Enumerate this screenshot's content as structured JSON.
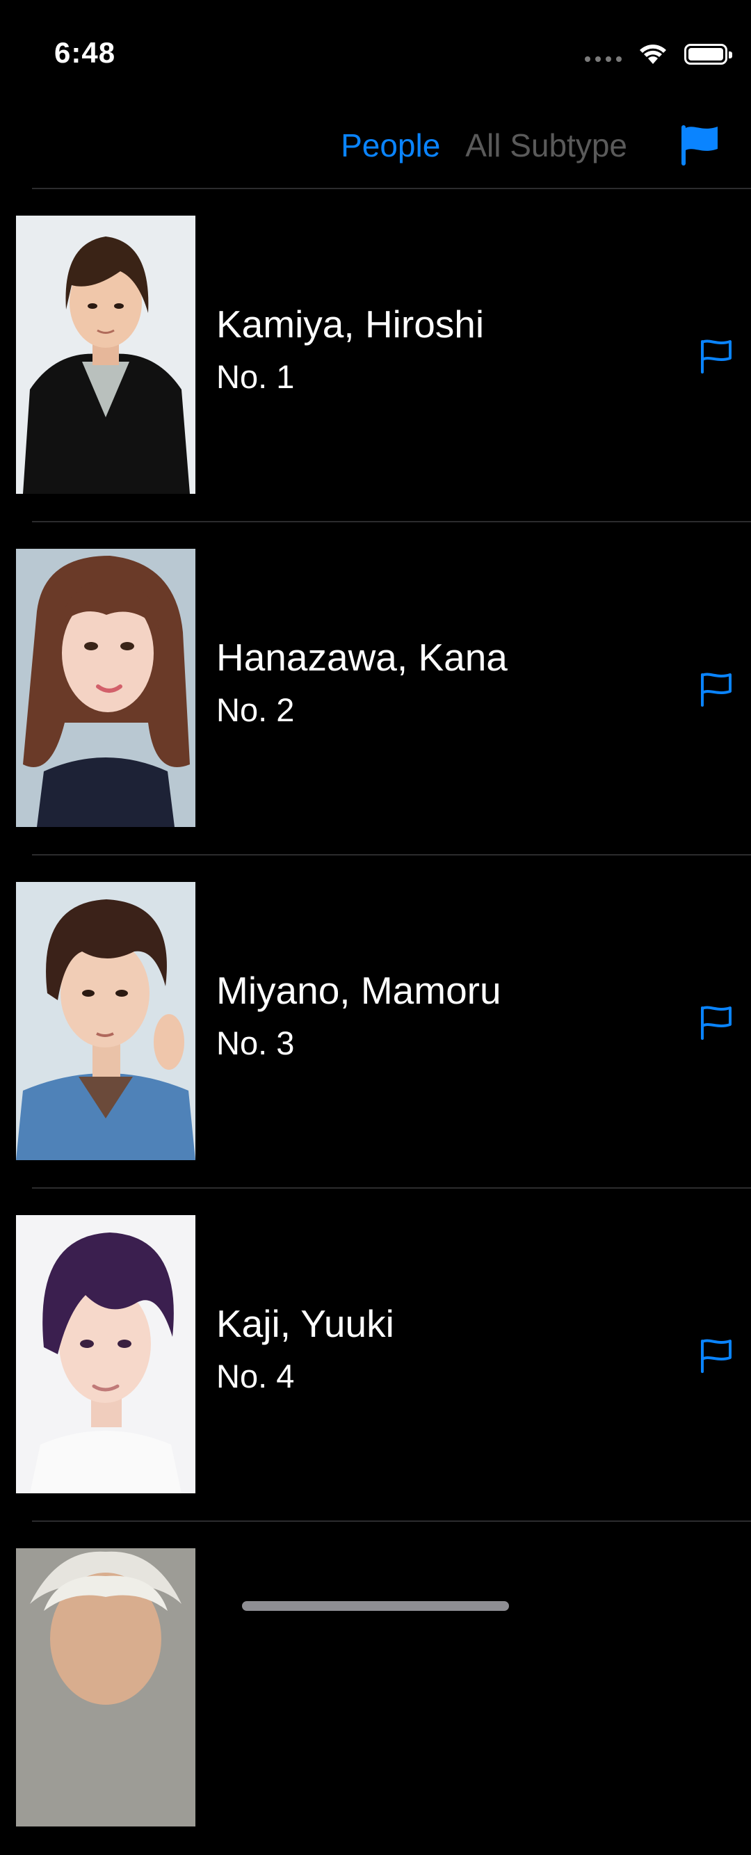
{
  "status_bar": {
    "time": "6:48"
  },
  "nav": {
    "segments": [
      {
        "label": "People",
        "selected": true
      },
      {
        "label": "All Subtype",
        "selected": false
      }
    ],
    "flag_icon": "flag-filled-icon"
  },
  "colors": {
    "accent": "#0a84ff",
    "background": "#000000",
    "divider": "#2c2c2e",
    "inactive": "#5a5a5a"
  },
  "people": [
    {
      "name": "Kamiya, Hiroshi",
      "number": "No. 1",
      "flag_icon": "flag-outline-icon"
    },
    {
      "name": "Hanazawa, Kana",
      "number": "No. 2",
      "flag_icon": "flag-outline-icon"
    },
    {
      "name": "Miyano, Mamoru",
      "number": "No. 3",
      "flag_icon": "flag-outline-icon"
    },
    {
      "name": "Kaji, Yuuki",
      "number": "No. 4",
      "flag_icon": "flag-outline-icon"
    },
    {
      "name": "",
      "number": "",
      "flag_icon": "flag-outline-icon"
    }
  ]
}
